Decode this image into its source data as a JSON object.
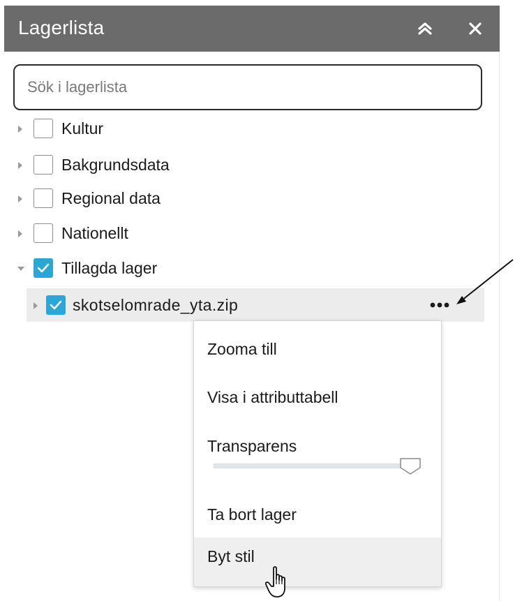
{
  "header": {
    "title": "Lagerlista",
    "collapse_icon": "double-chevron-up-icon",
    "close_icon": "close-icon"
  },
  "search": {
    "placeholder": "Sök i lagerlista",
    "value": ""
  },
  "layers": [
    {
      "label": "Kultur",
      "checked": false,
      "expanded": false
    },
    {
      "label": "Bakgrundsdata",
      "checked": false,
      "expanded": false
    },
    {
      "label": "Regional data",
      "checked": false,
      "expanded": false
    },
    {
      "label": "Nationellt",
      "checked": false,
      "expanded": false
    },
    {
      "label": "Tillagda lager",
      "checked": true,
      "expanded": true,
      "children": [
        {
          "label": "skotselomrade_yta.zip",
          "checked": true,
          "expanded": false,
          "more_icon": "ellipsis-icon"
        }
      ]
    }
  ],
  "context_menu": {
    "zoom_to": "Zooma till",
    "show_attribute_table": "Visa i attributtabell",
    "transparency": {
      "label": "Transparens",
      "value": 0.9
    },
    "remove_layer": "Ta bort lager",
    "change_style": "Byt stil"
  },
  "colors": {
    "header_bg": "#6b6b6b",
    "checkbox_checked": "#2aa7d6",
    "selected_row_bg": "#ececec",
    "hover_item_bg": "#efefef"
  }
}
